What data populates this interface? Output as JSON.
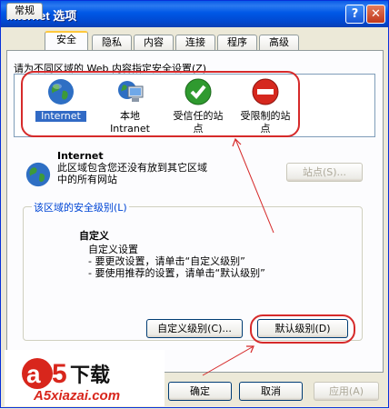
{
  "window": {
    "title": "Internet 选项"
  },
  "tabs": [
    "常规",
    "安全",
    "隐私",
    "内容",
    "连接",
    "程序",
    "高级"
  ],
  "zones_prompt": "请为不同区域的 Web 内容指定安全设置(Z)",
  "zones": [
    {
      "line1": "Internet",
      "line2": ""
    },
    {
      "line1": "本地",
      "line2": "Intranet"
    },
    {
      "line1": "受信任的站",
      "line2": "点"
    },
    {
      "line1": "受限制的站",
      "line2": "点"
    }
  ],
  "selected_zone": {
    "title": "Internet",
    "desc_line1": "此区域包含您还没有放到其它区域",
    "desc_line2": "中的所有网站"
  },
  "sites_button": "站点(S)...",
  "security_group": {
    "title": "该区域的安全级别(L)",
    "level": "自定义",
    "lines": [
      "自定义设置",
      "- 要更改设置，请单击“自定义级别”",
      "- 要使用推荐的设置，请单击“默认级别”"
    ]
  },
  "custom_level_button": "自定义级别(C)...",
  "default_level_button": "默认级别(D)",
  "footer": {
    "ok": "确定",
    "cancel": "取消",
    "apply": "应用(A)"
  },
  "watermark": {
    "brand": "A5下载",
    "url": "A5xiazai.com"
  },
  "colors": {
    "title_bar": "#0058e6",
    "selection": "#316ac5",
    "annotation": "#d62a2a"
  }
}
